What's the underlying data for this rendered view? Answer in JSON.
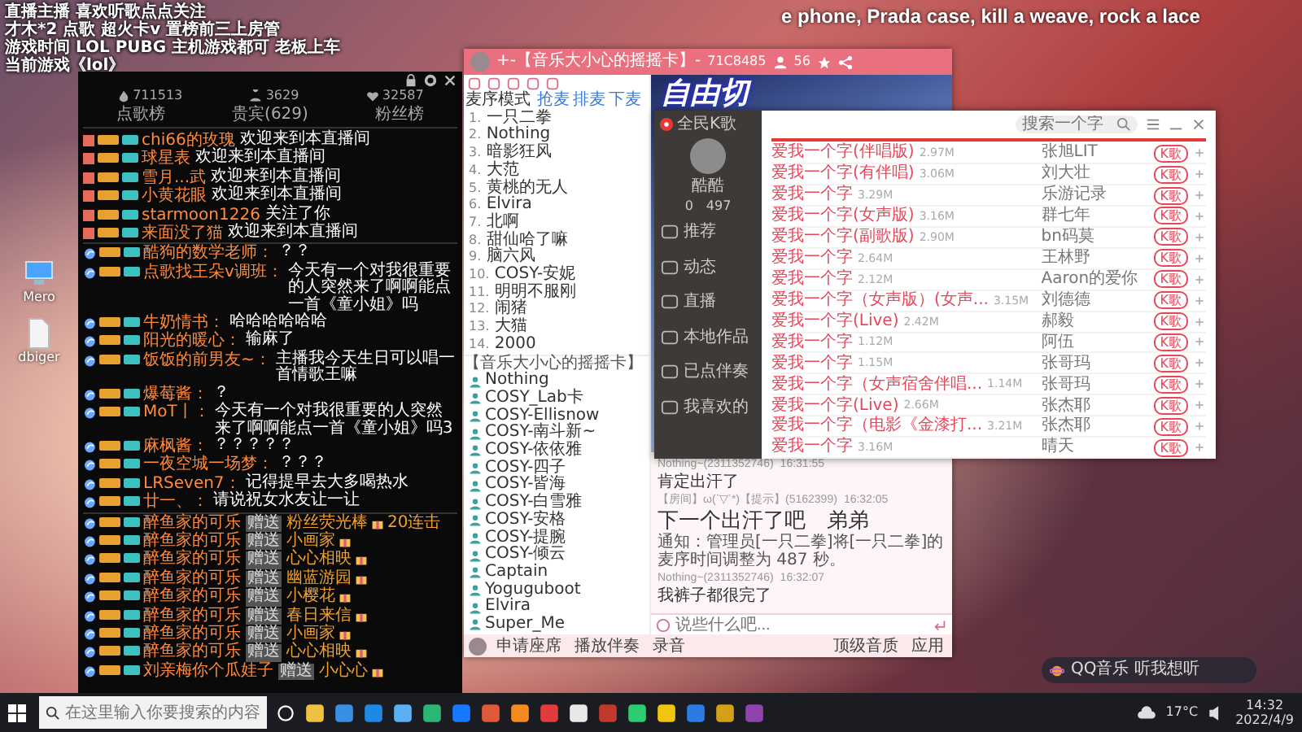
{
  "stream_overlay": {
    "lines": [
      "直播主播 喜欢听歌点点关注",
      "才木*2 点歌 超火卡v 置榜前三上房管",
      "游戏时间 LOL PUBG 主机游戏都可 老板上车",
      "当前游戏《lol》"
    ]
  },
  "lyrics": "e phone, Prada case, kill a weave, rock a lace",
  "desktop_icons": [
    {
      "label": "Mero"
    },
    {
      "label": "dbiger"
    }
  ],
  "chat_panel": {
    "stats": [
      {
        "kind": "heat",
        "value": "711513"
      },
      {
        "kind": "viewers",
        "value": "3629"
      },
      {
        "kind": "fans",
        "value": "32587"
      }
    ],
    "tabs": [
      {
        "label": "点歌榜",
        "selected": false
      },
      {
        "label": "贵宾(629)",
        "selected": false
      },
      {
        "label": "粉丝榜",
        "selected": false
      }
    ],
    "entries": [
      {
        "kind": "enter",
        "name": "chi66的玫瑰",
        "text": "欢迎来到本直播间"
      },
      {
        "kind": "enter",
        "name": "球星表",
        "text": "欢迎来到本直播间"
      },
      {
        "kind": "enter",
        "name": "雪月...武",
        "text": "欢迎来到本直播间"
      },
      {
        "kind": "enter",
        "name": "小黄花眼",
        "text": "欢迎来到本直播间"
      },
      {
        "kind": "enter",
        "name": "starmoon1226",
        "text": "关注了你"
      },
      {
        "kind": "enter",
        "name": "来面没了猫",
        "text": "欢迎来到本直播间"
      },
      {
        "kind": "chat",
        "name": "酷狗的数学老师：",
        "text": "？？"
      },
      {
        "kind": "chat",
        "name": "点歌找王朵v调班：",
        "text": "今天有一个对我很重要的人突然来了啊啊能点一首《童小姐》吗"
      },
      {
        "kind": "chat",
        "name": "牛奶情书：",
        "text": "哈哈哈哈哈哈"
      },
      {
        "kind": "chat",
        "name": "阳光的暖心：",
        "text": "输麻了"
      },
      {
        "kind": "chat",
        "name": "饭饭的前男友~：",
        "text": "主播我今天生日可以唱一首情歌王嘛"
      },
      {
        "kind": "chat",
        "name": "爆莓酱：",
        "text": "？"
      },
      {
        "kind": "chat",
        "name": "MoT丨：",
        "text": "今天有一个对我很重要的人突然来了啊啊能点一首《童小姐》吗3"
      },
      {
        "kind": "chat",
        "name": "麻枫酱：",
        "text": "？？？？？"
      },
      {
        "kind": "chat",
        "name": "一夜空城一场梦：",
        "text": "？？？"
      },
      {
        "kind": "chat",
        "name": "LRSeven7：",
        "text": "记得提早去大多喝热水"
      },
      {
        "kind": "chat",
        "name": "廿一、：",
        "text": "请说祝女水友让一让"
      },
      {
        "kind": "gift",
        "name": "醉鱼家的可乐",
        "verb": "赠送",
        "gift": "粉丝荧光棒",
        "combo": "20连击"
      },
      {
        "kind": "gift",
        "name": "醉鱼家的可乐",
        "verb": "赠送",
        "gift": "小画家"
      },
      {
        "kind": "gift",
        "name": "醉鱼家的可乐",
        "verb": "赠送",
        "gift": "心心相映"
      },
      {
        "kind": "gift",
        "name": "醉鱼家的可乐",
        "verb": "赠送",
        "gift": "幽蓝游园"
      },
      {
        "kind": "gift",
        "name": "醉鱼家的可乐",
        "verb": "赠送",
        "gift": "小樱花"
      },
      {
        "kind": "gift",
        "name": "醉鱼家的可乐",
        "verb": "赠送",
        "gift": "春日来信"
      },
      {
        "kind": "gift",
        "name": "醉鱼家的可乐",
        "verb": "赠送",
        "gift": "小画家"
      },
      {
        "kind": "gift",
        "name": "醉鱼家的可乐",
        "verb": "赠送",
        "gift": "心心相映"
      },
      {
        "kind": "gift",
        "name": "刘亲梅你个瓜娃子",
        "verb": "赠送",
        "gift": "小心心"
      }
    ]
  },
  "yy_window": {
    "title": "+-【音乐大小心的摇摇卡】-",
    "room_id": "71C8485",
    "online": "56",
    "mode": "麦序模式",
    "mic_actions": [
      "抢麦",
      "排麦",
      "下麦"
    ],
    "mic_queue": [
      {
        "rank": "1.",
        "name": "一只二拳"
      },
      {
        "rank": "2.",
        "name": "Nothing"
      },
      {
        "rank": "3.",
        "name": "暗影狂风"
      },
      {
        "rank": "4.",
        "name": "大范"
      },
      {
        "rank": "5.",
        "name": "黄桃的无人"
      },
      {
        "rank": "6.",
        "name": "Elvira"
      },
      {
        "rank": "7.",
        "name": "北啊"
      },
      {
        "rank": "8.",
        "name": "甜仙哈了嘛"
      },
      {
        "rank": "9.",
        "name": "脑六风"
      },
      {
        "rank": "10.",
        "name": "COSY-安妮"
      },
      {
        "rank": "11.",
        "name": "明明不服刚"
      },
      {
        "rank": "12.",
        "name": "闹猪"
      },
      {
        "rank": "13.",
        "name": "大猫"
      },
      {
        "rank": "14.",
        "name": "2000"
      }
    ],
    "channel": "【音乐大小心的摇摇卡】",
    "members": [
      "Nothing",
      "COSY_Lab卡",
      "COSY-Ellisnow",
      "COSY-南斗新~",
      "COSY-依依雅",
      "COSY-四子",
      "COSY-皆海",
      "COSY-白雪雅",
      "COSY-安格",
      "COSY-提腕",
      "COSY-倾云",
      "Captain",
      "Yoguguboot",
      "Elvira",
      "Super_Me"
    ],
    "banner": "自由切",
    "messages": [
      {
        "kind": "user",
        "sender": "Nothing~(2311352746)",
        "time": "16:31:55",
        "text": "肯定出汗了"
      },
      {
        "kind": "big",
        "sender": "【房间】ω(ˊ▽ˋ*)【提示】(5162399)",
        "time": "16:32:05",
        "text": "下一个出汗了吧　弟弟"
      },
      {
        "kind": "notice",
        "text": "通知：管理员[一只二拳]将[一只二拳]的麦序时间调整为 487 秒。"
      },
      {
        "kind": "user",
        "sender": "Nothing~(2311352746)",
        "time": "16:32:07",
        "text": "我裤子都很完了"
      }
    ],
    "input": {
      "placeholder": "说些什么吧..."
    },
    "toolbar": [
      "申请座席",
      "播放伴奏",
      "录音"
    ],
    "toolbar_right": [
      "顶级音质",
      "应用"
    ]
  },
  "music_window": {
    "app_name": "全民K歌",
    "user": {
      "name": "酷酷",
      "fans": "0",
      "likes": "497"
    },
    "nav": [
      "推荐",
      "动态",
      "直播",
      "本地作品",
      "已点伴奏",
      "我喜欢的"
    ],
    "search": {
      "placeholder": "搜索一个字"
    },
    "songs": [
      {
        "title": "爱我一个字(伴唱版)",
        "size": "2.97M",
        "singer": "张旭LIT",
        "button": "K歌"
      },
      {
        "title": "爱我一个字(有伴唱)",
        "size": "3.06M",
        "singer": "刘大壮",
        "button": "K歌"
      },
      {
        "title": "爱我一个字",
        "size": "3.29M",
        "singer": "乐游记录",
        "button": "K歌"
      },
      {
        "title": "爱我一个字(女声版)",
        "size": "3.16M",
        "singer": "群七年",
        "button": "K歌"
      },
      {
        "title": "爱我一个字(副歌版)",
        "size": "2.90M",
        "singer": "bn码莫",
        "button": "K歌"
      },
      {
        "title": "爱我一个字",
        "size": "2.64M",
        "singer": "王林野",
        "button": "K歌"
      },
      {
        "title": "爱我一个字",
        "size": "2.12M",
        "singer": "Aaron的爱你",
        "button": "K歌"
      },
      {
        "title": "爱我一个字（女声版）(女声...",
        "size": "3.15M",
        "singer": "刘德德",
        "button": "K歌"
      },
      {
        "title": "爱我一个字(Live)",
        "size": "2.42M",
        "singer": "郝毅",
        "button": "K歌"
      },
      {
        "title": "爱我一个字",
        "size": "1.12M",
        "singer": "阿伍",
        "button": "K歌"
      },
      {
        "title": "爱我一个字",
        "size": "1.15M",
        "singer": "张哥玛",
        "button": "K歌"
      },
      {
        "title": "爱我一个字（女声宿舍伴唱...",
        "size": "1.14M",
        "singer": "张哥玛",
        "button": "K歌"
      },
      {
        "title": "爱我一个字(Live)",
        "size": "2.66M",
        "singer": "张杰耶",
        "button": "K歌"
      },
      {
        "title": "爱我一个字（电影《金漆打...",
        "size": "3.21M",
        "singer": "张杰耶",
        "button": "K歌"
      },
      {
        "title": "爱我一个字",
        "size": "3.16M",
        "singer": "晴天",
        "button": "K歌"
      }
    ]
  },
  "music_widget": {
    "text": "QQ音乐 听我想听"
  },
  "taskbar": {
    "search_placeholder": "在这里输入你要搜索的内容",
    "weather": "17°C",
    "time": "14:32",
    "date": "2022/4/9"
  }
}
